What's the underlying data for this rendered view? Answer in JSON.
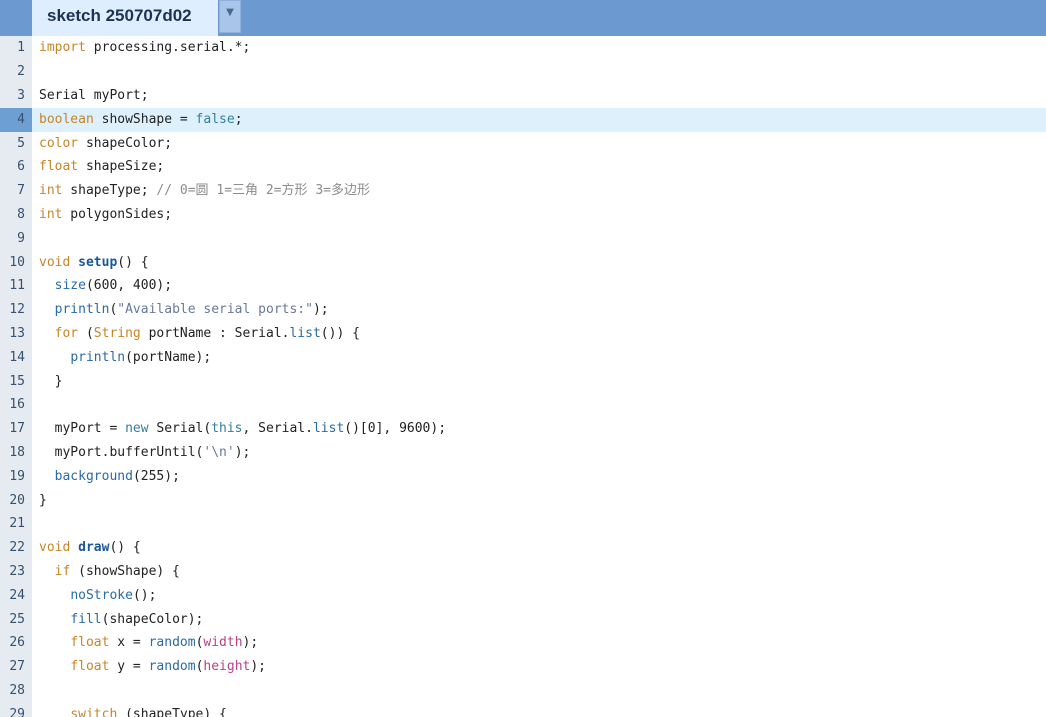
{
  "tab": {
    "title": "sketch 250707d02",
    "menu_glyph": "▼"
  },
  "editor": {
    "current_line": 4,
    "lines": [
      {
        "n": "1",
        "tokens": [
          [
            "kw",
            "import"
          ],
          [
            "p",
            " processing.serial.*;"
          ]
        ]
      },
      {
        "n": "2",
        "tokens": []
      },
      {
        "n": "3",
        "tokens": [
          [
            "p",
            "Serial myPort;"
          ]
        ]
      },
      {
        "n": "4",
        "tokens": [
          [
            "kw",
            "boolean"
          ],
          [
            "p",
            " showShape = "
          ],
          [
            "lt",
            "false"
          ],
          [
            "p",
            ";"
          ]
        ]
      },
      {
        "n": "5",
        "tokens": [
          [
            "kw",
            "color"
          ],
          [
            "p",
            " shapeColor;"
          ]
        ]
      },
      {
        "n": "6",
        "tokens": [
          [
            "kw",
            "float"
          ],
          [
            "p",
            " shapeSize;"
          ]
        ]
      },
      {
        "n": "7",
        "tokens": [
          [
            "kw",
            "int"
          ],
          [
            "p",
            " shapeType; "
          ],
          [
            "cm",
            "// 0=圆 1=三角 2=方形 3=多边形"
          ]
        ]
      },
      {
        "n": "8",
        "tokens": [
          [
            "kw",
            "int"
          ],
          [
            "p",
            " polygonSides;"
          ]
        ]
      },
      {
        "n": "9",
        "tokens": []
      },
      {
        "n": "10",
        "tokens": [
          [
            "kw",
            "void"
          ],
          [
            "p",
            " "
          ],
          [
            "fd",
            "setup"
          ],
          [
            "p",
            "() {"
          ]
        ]
      },
      {
        "n": "11",
        "tokens": [
          [
            "p",
            "  "
          ],
          [
            "fn",
            "size"
          ],
          [
            "p",
            "(600, 400);"
          ]
        ]
      },
      {
        "n": "12",
        "tokens": [
          [
            "p",
            "  "
          ],
          [
            "fn",
            "println"
          ],
          [
            "p",
            "("
          ],
          [
            "st",
            "\"Available serial ports:\""
          ],
          [
            "p",
            ");"
          ]
        ]
      },
      {
        "n": "13",
        "tokens": [
          [
            "p",
            "  "
          ],
          [
            "kw",
            "for"
          ],
          [
            "p",
            " ("
          ],
          [
            "kw",
            "String"
          ],
          [
            "p",
            " portName : Serial."
          ],
          [
            "fn",
            "list"
          ],
          [
            "p",
            "()) {"
          ]
        ]
      },
      {
        "n": "14",
        "tokens": [
          [
            "p",
            "    "
          ],
          [
            "fn",
            "println"
          ],
          [
            "p",
            "(portName);"
          ]
        ]
      },
      {
        "n": "15",
        "tokens": [
          [
            "p",
            "  }"
          ]
        ]
      },
      {
        "n": "16",
        "tokens": []
      },
      {
        "n": "17",
        "tokens": [
          [
            "p",
            "  myPort = "
          ],
          [
            "lt",
            "new"
          ],
          [
            "p",
            " Serial("
          ],
          [
            "lt",
            "this"
          ],
          [
            "p",
            ", Serial."
          ],
          [
            "fn",
            "list"
          ],
          [
            "p",
            "()[0], 9600);"
          ]
        ]
      },
      {
        "n": "18",
        "tokens": [
          [
            "p",
            "  myPort.bufferUntil("
          ],
          [
            "st",
            "'\\n'"
          ],
          [
            "p",
            ");"
          ]
        ]
      },
      {
        "n": "19",
        "tokens": [
          [
            "p",
            "  "
          ],
          [
            "fn",
            "background"
          ],
          [
            "p",
            "(255);"
          ]
        ]
      },
      {
        "n": "20",
        "tokens": [
          [
            "p",
            "}"
          ]
        ]
      },
      {
        "n": "21",
        "tokens": []
      },
      {
        "n": "22",
        "tokens": [
          [
            "kw",
            "void"
          ],
          [
            "p",
            " "
          ],
          [
            "fd",
            "draw"
          ],
          [
            "p",
            "() {"
          ]
        ]
      },
      {
        "n": "23",
        "tokens": [
          [
            "p",
            "  "
          ],
          [
            "kw",
            "if"
          ],
          [
            "p",
            " (showShape) {"
          ]
        ]
      },
      {
        "n": "24",
        "tokens": [
          [
            "p",
            "    "
          ],
          [
            "fn",
            "noStroke"
          ],
          [
            "p",
            "();"
          ]
        ]
      },
      {
        "n": "25",
        "tokens": [
          [
            "p",
            "    "
          ],
          [
            "fn",
            "fill"
          ],
          [
            "p",
            "(shapeColor);"
          ]
        ]
      },
      {
        "n": "26",
        "tokens": [
          [
            "p",
            "    "
          ],
          [
            "kw",
            "float"
          ],
          [
            "p",
            " x = "
          ],
          [
            "fn",
            "random"
          ],
          [
            "p",
            "("
          ],
          [
            "bi",
            "width"
          ],
          [
            "p",
            ");"
          ]
        ]
      },
      {
        "n": "27",
        "tokens": [
          [
            "p",
            "    "
          ],
          [
            "kw",
            "float"
          ],
          [
            "p",
            " y = "
          ],
          [
            "fn",
            "random"
          ],
          [
            "p",
            "("
          ],
          [
            "bi",
            "height"
          ],
          [
            "p",
            ");"
          ]
        ]
      },
      {
        "n": "28",
        "tokens": []
      },
      {
        "n": "29",
        "tokens": [
          [
            "p",
            "    "
          ],
          [
            "kw",
            "switch"
          ],
          [
            "p",
            " (shapeType) {"
          ]
        ]
      }
    ]
  }
}
